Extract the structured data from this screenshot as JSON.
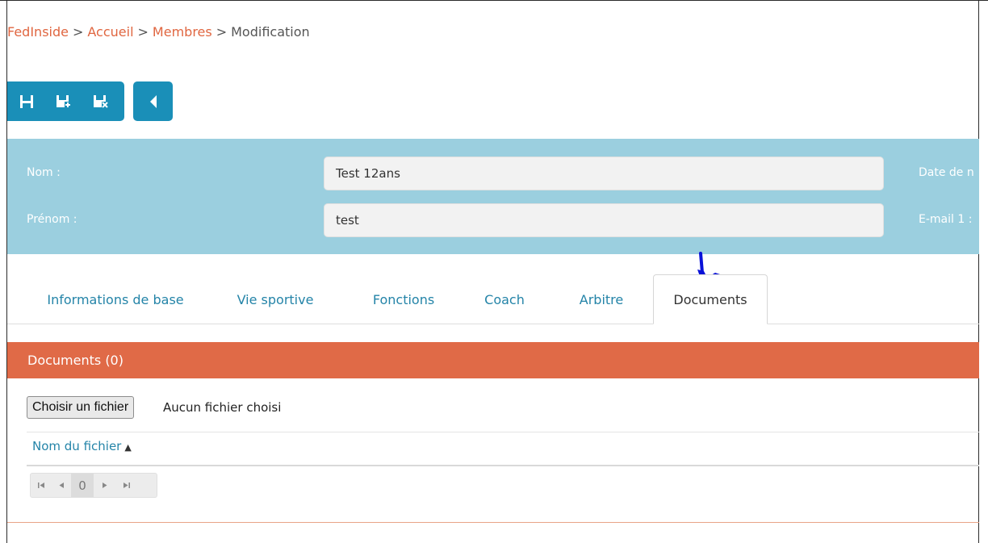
{
  "breadcrumb": {
    "root": "FedInside",
    "accueil": "Accueil",
    "membres": "Membres",
    "current": "Modification",
    "separator": ">"
  },
  "toolbar": {
    "icons": [
      "save-icon",
      "save-new-icon",
      "save-close-icon",
      "back-arrow-icon"
    ],
    "accent": "#1a8fb8"
  },
  "member": {
    "nom_label": "Nom :",
    "nom_value": "Test 12ans",
    "prenom_label": "Prénom :",
    "prenom_value": "test",
    "date_label": "Date de n",
    "email_label": "E-mail 1 :"
  },
  "tabs": [
    {
      "label": "Informations de base"
    },
    {
      "label": "Vie sportive"
    },
    {
      "label": "Fonctions"
    },
    {
      "label": "Coach"
    },
    {
      "label": "Arbitre"
    },
    {
      "label": "Documents"
    }
  ],
  "active_tab": "Documents",
  "documents": {
    "title": "Documents (0)",
    "file_button": "Choisir un fichier",
    "file_status": "Aucun fichier choisi",
    "column_header": "Nom du fichier",
    "sort_indicator": "▲",
    "pager": {
      "first": "⏮",
      "prev": "◀",
      "page": "0",
      "next": "▶",
      "last": "⏭"
    }
  },
  "colors": {
    "band": "#9bcfdf",
    "panel_header": "#e06a47",
    "link": "#e06640",
    "tab_text": "#2484a8"
  }
}
